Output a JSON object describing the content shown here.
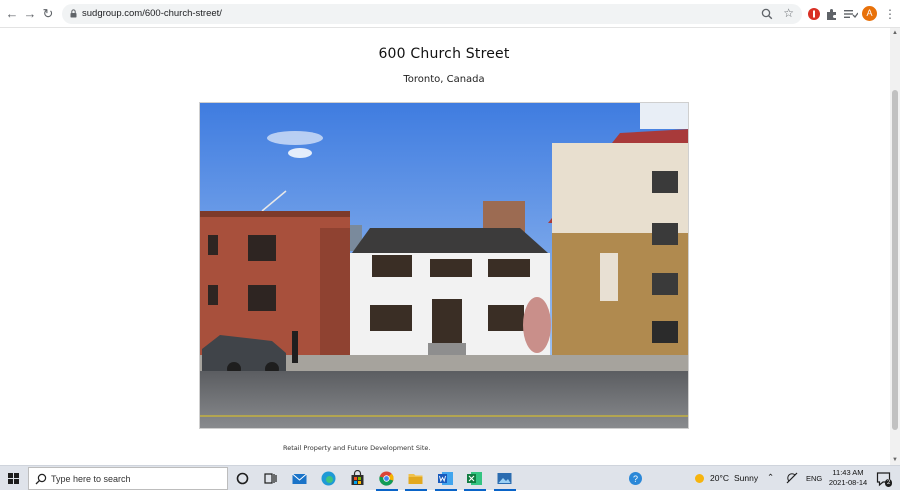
{
  "browser": {
    "url": "sudgroup.com/600-church-street/",
    "avatar_initial": "A",
    "accent": "#e8710a"
  },
  "page": {
    "title": "600 Church Street",
    "subtitle": "Toronto, Canada",
    "caption": "Retail Property and Future Development Site."
  },
  "taskbar": {
    "search_placeholder": "Type here to search",
    "weather_temp": "20°C",
    "weather_text": "Sunny",
    "language": "ENG",
    "time": "11:43 AM",
    "date": "2021-08-14",
    "notification_count": "2",
    "apps": [
      "task-view",
      "mail",
      "edge",
      "store",
      "chrome",
      "file-explorer",
      "word",
      "excel",
      "photos"
    ]
  }
}
